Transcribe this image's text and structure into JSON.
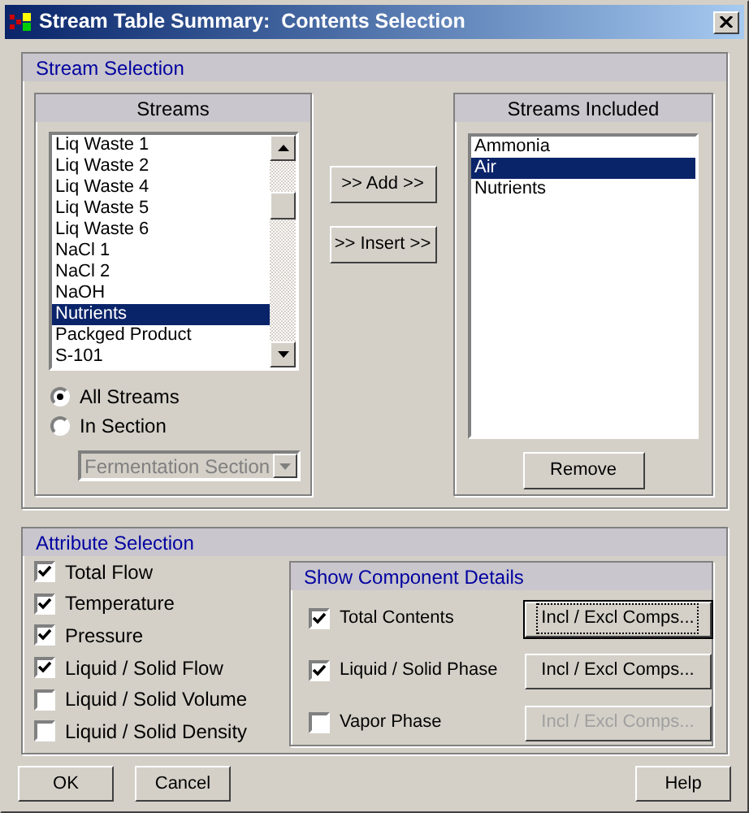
{
  "window": {
    "title": "Stream Table Summary:  Contents Selection"
  },
  "stream_selection": {
    "title": "Stream Selection",
    "streams": {
      "title": "Streams",
      "items": [
        {
          "label": "Liq Waste 1",
          "selected": false
        },
        {
          "label": "Liq Waste 2",
          "selected": false
        },
        {
          "label": "Liq Waste 4",
          "selected": false
        },
        {
          "label": "Liq Waste 5",
          "selected": false
        },
        {
          "label": "Liq Waste 6",
          "selected": false
        },
        {
          "label": "NaCl 1",
          "selected": false
        },
        {
          "label": "NaCl 2",
          "selected": false
        },
        {
          "label": "NaOH",
          "selected": false
        },
        {
          "label": "Nutrients",
          "selected": true
        },
        {
          "label": "Packged Product",
          "selected": false
        },
        {
          "label": "S-101",
          "selected": false
        }
      ]
    },
    "scope": [
      {
        "label": "All Streams",
        "selected": true
      },
      {
        "label": "In Section",
        "selected": false
      }
    ],
    "section_dropdown": {
      "value": "Fermentation Section",
      "disabled": true
    },
    "add_button": ">> Add >>",
    "insert_button": ">> Insert >>",
    "included": {
      "title": "Streams Included",
      "items": [
        {
          "label": "Ammonia",
          "selected": false
        },
        {
          "label": "Air",
          "selected": true
        },
        {
          "label": "Nutrients",
          "selected": false
        }
      ]
    },
    "remove_button": "Remove"
  },
  "attribute_selection": {
    "title": "Attribute Selection",
    "attributes": [
      {
        "label": "Total Flow",
        "checked": true
      },
      {
        "label": "Temperature",
        "checked": true
      },
      {
        "label": "Pressure",
        "checked": true
      },
      {
        "label": "Liquid / Solid Flow",
        "checked": true
      },
      {
        "label": "Liquid / Solid Volume",
        "checked": false
      },
      {
        "label": "Liquid / Solid Density",
        "checked": false
      }
    ],
    "component_details": {
      "title": "Show Component Details",
      "rows": [
        {
          "label": "Total Contents",
          "checked": true,
          "button": "Incl / Excl Comps...",
          "disabled": false,
          "focused": true
        },
        {
          "label": "Liquid / Solid Phase",
          "checked": true,
          "button": "Incl / Excl Comps...",
          "disabled": false,
          "focused": false
        },
        {
          "label": "Vapor Phase",
          "checked": false,
          "button": "Incl / Excl Comps...",
          "disabled": true,
          "focused": false
        }
      ]
    }
  },
  "buttons": [
    "OK",
    "Cancel",
    "Help"
  ]
}
